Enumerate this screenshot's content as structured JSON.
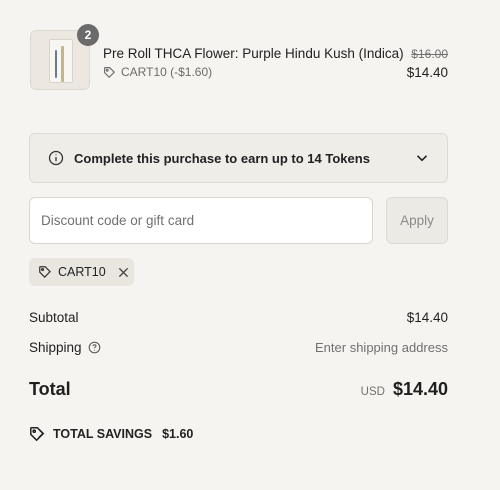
{
  "cart": {
    "items": [
      {
        "quantity": "2",
        "title": "Pre Roll THCA Flower: Purple Hindu Kush (Indica)",
        "discount": "CART10 (-$1.60)",
        "original_price": "$16.00",
        "price": "$14.40"
      }
    ]
  },
  "tokens_banner": {
    "text": "Complete this purchase to earn up to 14 Tokens"
  },
  "discount": {
    "placeholder": "Discount code or gift card",
    "apply_label": "Apply",
    "applied_code": "CART10"
  },
  "summary": {
    "subtotal_label": "Subtotal",
    "subtotal_value": "$14.40",
    "shipping_label": "Shipping",
    "shipping_value": "Enter shipping address",
    "total_label": "Total",
    "currency": "USD",
    "total_value": "$14.40",
    "savings_label": "TOTAL SAVINGS",
    "savings_value": "$1.60"
  },
  "icons": {
    "tag": "tag-icon",
    "info": "info-icon",
    "chevron": "chevron-down-icon",
    "close": "close-icon",
    "help": "help-circle-icon",
    "savings": "savings-tag-icon"
  }
}
